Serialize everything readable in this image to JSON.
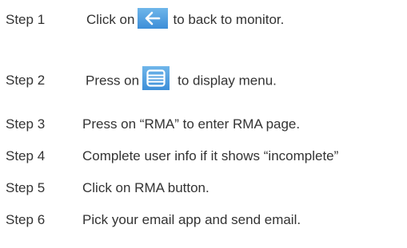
{
  "steps": [
    {
      "label": "Step 1",
      "text_before": "Click on",
      "icon": "back-arrow-icon",
      "text_after": "to back to monitor."
    },
    {
      "label": "Step 2",
      "text_before": "Press on",
      "icon": "menu-list-icon",
      "text_after": "to display menu."
    },
    {
      "label": "Step 3",
      "text": "Press on “RMA” to enter RMA page."
    },
    {
      "label": "Step 4",
      "text": "Complete user info if it shows “incomplete”"
    },
    {
      "label": "Step 5",
      "text": "Click on RMA button."
    },
    {
      "label": "Step 6",
      "text": "Pick your email app and send email."
    }
  ],
  "colors": {
    "text": "#333333",
    "icon_background": "#4a9be0",
    "icon_foreground": "#ffffff"
  }
}
